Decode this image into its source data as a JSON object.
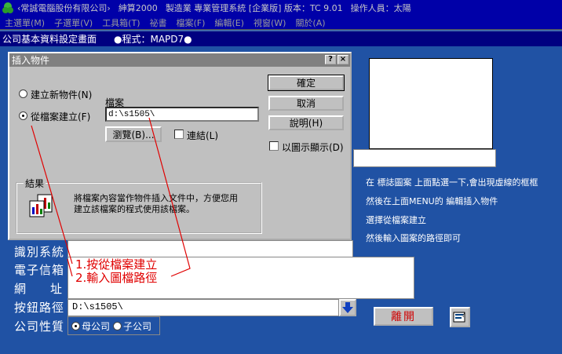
{
  "titlebar": {
    "company": "‹常誠電腦股份有限公司›",
    "product": "紳算2000",
    "system": "製造業 專業管理系統 [企業版] 版本：TC  9.01",
    "operator": "操作人員：太陽"
  },
  "menubar": {
    "items": [
      "主選單(M)",
      "子選單(V)",
      "工具箱(T)",
      "祕書",
      "檔案(F)",
      "編輯(E)",
      "視窗(W)",
      "關於(A)"
    ]
  },
  "form": {
    "title": "公司基本資料設定畫面",
    "program": "●程式：MAPD7●"
  },
  "help_text": {
    "line1": "在 標誌圖案 上面點選一下,會出現虛線的框框",
    "line2": "然後在上面MENU的 編輯插入物件",
    "line3": "選擇從檔案建立",
    "line4": "然後輸入圖案的路徑即可"
  },
  "fields": {
    "id_system": "識別系統",
    "email": "電子信箱",
    "website_a": "網",
    "website_b": "址",
    "button_path": "按鈕路徑",
    "button_path_value": "D:\\s1505\\",
    "company_type": "公司性質",
    "type_parent": "母公司",
    "type_sub": "子公司"
  },
  "leave_button": "離開",
  "dialog": {
    "title": "插入物件",
    "help_btn": "?",
    "close_btn": "×",
    "create_new": "建立新物件(N)",
    "create_from_file": "從檔案建立(F)",
    "file_label": "檔案",
    "file_value": "d:\\s1505\\",
    "browse": "瀏覽(B)...",
    "link": "連結(L)",
    "ok": "確定",
    "cancel": "取消",
    "help": "說明(H)",
    "show_as_icon": "以圖示顯示(D)",
    "result_label": "結果",
    "result_text1": "將檔案內容當作物件插入文件中，方便您用",
    "result_text2": "建立該檔案的程式使用該檔案。"
  },
  "annotations": {
    "step1": "1.按從檔案建立",
    "step2": "2.輸入圖檔路徑"
  },
  "colors": {
    "form_background": "#2052a4",
    "titlebar": "#0000a8",
    "annotation": "#e00000"
  }
}
